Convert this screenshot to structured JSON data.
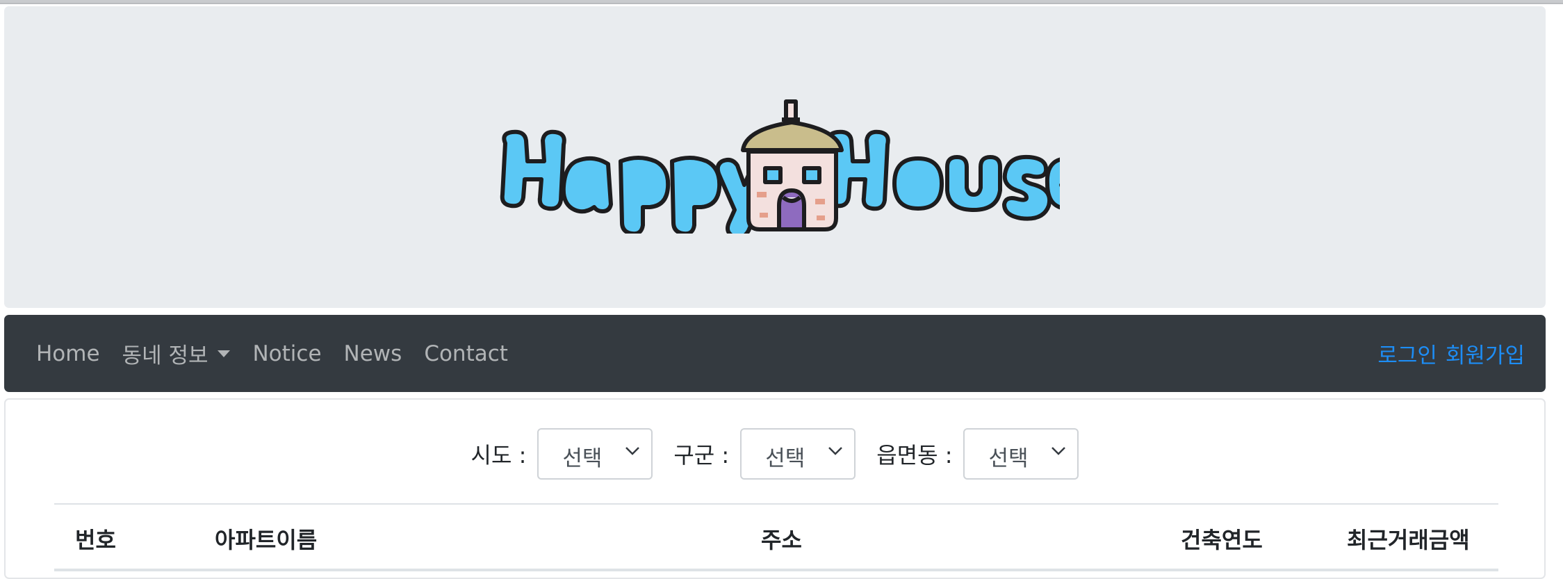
{
  "brand": {
    "logo_text": "HappyHouse",
    "logo_colors": {
      "letters": "#5bc8f5",
      "outline": "#1d1d1f",
      "roof": "#c9bd8c",
      "door": "#8e6bbf"
    }
  },
  "nav": {
    "items": [
      {
        "label": "Home"
      },
      {
        "label": "동네 정보",
        "dropdown": true,
        "icon": "caret-down-icon"
      },
      {
        "label": "Notice"
      },
      {
        "label": "News"
      },
      {
        "label": "Contact"
      }
    ],
    "auth": {
      "login": "로그인",
      "signup": "회원가입"
    },
    "colors": {
      "bg": "#343a40",
      "link": "#1d8df5"
    }
  },
  "filters": {
    "sido": {
      "label": "시도 :",
      "value": "선택"
    },
    "gugun": {
      "label": "구군 :",
      "value": "선택"
    },
    "dong": {
      "label": "읍면동 :",
      "value": "선택"
    }
  },
  "table": {
    "headers": [
      "번호",
      "아파트이름",
      "주소",
      "건축연도",
      "최근거래금액"
    ]
  }
}
